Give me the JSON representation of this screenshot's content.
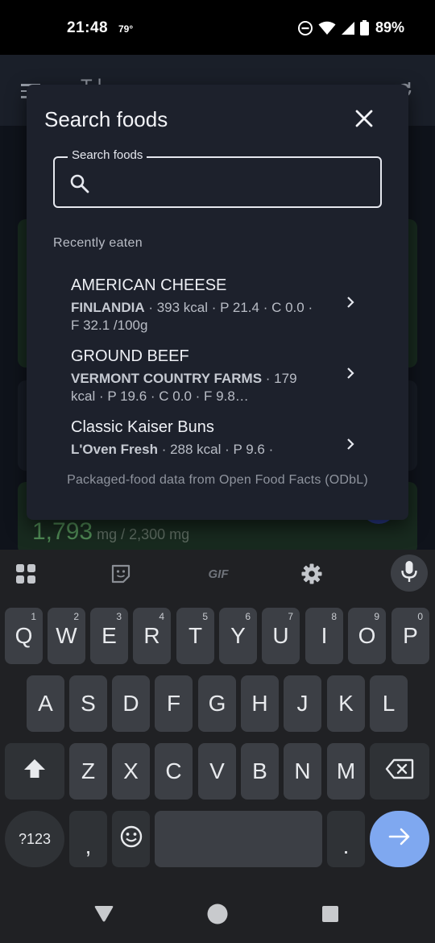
{
  "status_bar": {
    "time": "21:48",
    "temperature": "79°",
    "battery": "89%",
    "icons": [
      "do-not-disturb-icon",
      "wifi-icon",
      "cellular-signal-icon",
      "battery-icon"
    ]
  },
  "background_app": {
    "title_fragment": "T  l",
    "sodium_value": "1,793",
    "sodium_limit": " mg / 2,300 mg"
  },
  "dialog": {
    "title": "Search foods",
    "search": {
      "label": "Search foods",
      "value": "",
      "placeholder": ""
    },
    "recent_heading": "Recently eaten",
    "items": [
      {
        "name": "AMERICAN CHEESE",
        "brand": "FINLANDIA",
        "details": " · 393 kcal · P 21.4 · C 0.0 · F 32.1 /100g"
      },
      {
        "name": "GROUND BEEF",
        "brand": "VERMONT COUNTRY FARMS",
        "details": " · 179 kcal · P 19.6 · C 0.0 · F 9.8…"
      },
      {
        "name": "Classic Kaiser Buns",
        "brand": "L'Oven Fresh",
        "details": " · 288 kcal · P 9.6 ·"
      }
    ],
    "attribution": "Packaged-food data from Open Food Facts (ODbL)"
  },
  "keyboard": {
    "toolbar": {
      "gif_label": "GIF"
    },
    "row1": [
      {
        "key": "Q",
        "hint": "1"
      },
      {
        "key": "W",
        "hint": "2"
      },
      {
        "key": "E",
        "hint": "3"
      },
      {
        "key": "R",
        "hint": "4"
      },
      {
        "key": "T",
        "hint": "5"
      },
      {
        "key": "Y",
        "hint": "6"
      },
      {
        "key": "U",
        "hint": "7"
      },
      {
        "key": "I",
        "hint": "8"
      },
      {
        "key": "O",
        "hint": "9"
      },
      {
        "key": "P",
        "hint": "0"
      }
    ],
    "row2": [
      "A",
      "S",
      "D",
      "F",
      "G",
      "H",
      "J",
      "K",
      "L"
    ],
    "row3": [
      "Z",
      "X",
      "C",
      "V",
      "B",
      "N",
      "M"
    ],
    "symbols_label": "?123",
    "comma_label": ",",
    "period_label": "."
  },
  "colors": {
    "accent": "#7fa8f0",
    "dialog_bg": "#1d212c",
    "keyboard_bg": "#202124",
    "key_bg": "#3c3f45",
    "sodium_green": "#4f8a55"
  }
}
